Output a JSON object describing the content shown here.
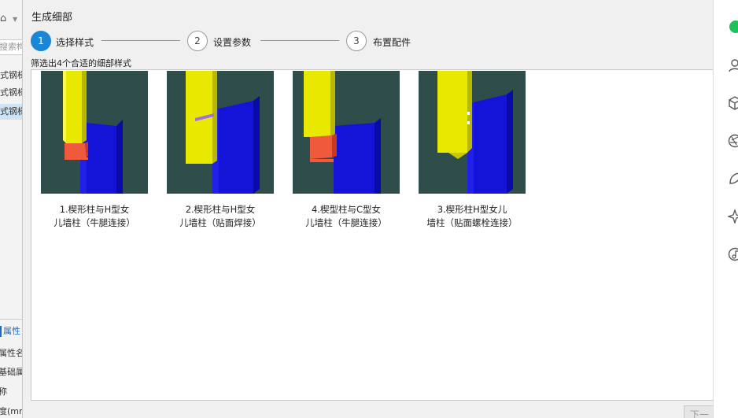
{
  "background_left": {
    "search_placeholder": "搜索构",
    "rows": [
      "式钢梯",
      "式钢梯",
      "式钢梯"
    ],
    "props_header": "属性",
    "prop_rows": [
      "属性名",
      "基础属",
      "称",
      "度(mm"
    ]
  },
  "dialog": {
    "title": "生成细部",
    "steps": [
      {
        "num": "1",
        "label": "选择样式",
        "active": true
      },
      {
        "num": "2",
        "label": "设置参数",
        "active": false
      },
      {
        "num": "3",
        "label": "布置配件",
        "active": false
      }
    ],
    "filter_text": "筛选出4个合适的细部样式",
    "styles": [
      {
        "line1": "1.楔形柱与H型女",
        "line2": "儿墙柱（牛腿连接）",
        "variant": "bracket-h"
      },
      {
        "line1": "2.楔形柱与H型女",
        "line2": "儿墙柱（贴面焊接）",
        "variant": "weld-h"
      },
      {
        "line1": "4.楔型柱与C型女",
        "line2": "儿墙柱（牛腿连接）",
        "variant": "bracket-c"
      },
      {
        "line1": "3.楔形柱H型女儿",
        "line2": "墙柱（贴面螺栓连接）",
        "variant": "bolt-h"
      }
    ],
    "next_label": "下一"
  },
  "colors": {
    "accent": "#1a86d8",
    "thumb_bg": "#2f4d4a",
    "yellow_column": "#e8e800",
    "blue_column": "#1414d8",
    "bracket": "#f05a3c"
  },
  "right_icons": [
    "chat-icon",
    "user-icon",
    "cube-icon",
    "aperture-icon",
    "leaf-icon",
    "sparkle-icon",
    "music-icon"
  ]
}
